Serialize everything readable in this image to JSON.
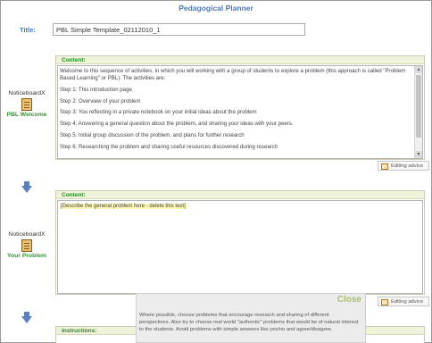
{
  "header": {
    "title": "Pedagogical Planner"
  },
  "title_field": {
    "label": "Title:",
    "value": "PBL Simple Template_02112010_1"
  },
  "activities": [
    {
      "tool_name": "NoticeboardX",
      "tool_label": "PBL Welcome",
      "panel_label": "Content:",
      "paragraphs": [
        "Welcome to this sequence of activities, in which you will working with a group of students to explore a problem (this approach is called \"Problem Based Learning\" or PBL). The activities are:",
        "Step 1: This introduction page",
        "Step 2: Overview of your problem",
        "Step 3: You reflecting in a private notebook on your initial ideas about the problem",
        "Step 4: Answering a general question about the problem, and sharing your ideas with your peers.",
        "Step 5: Initial group discussion of the problem, and plans for further research",
        "Step 6: Researching the problem and sharing useful resources discovered during research"
      ],
      "editing_advice": "Editing advice"
    },
    {
      "tool_name": "NoticeboardX",
      "tool_label": "Your Problem",
      "panel_label": "Content:",
      "placeholder_text": "[Describe the general problem here - delete this text]",
      "editing_advice": "Editing advice"
    },
    {
      "panel_label": "Instructions:"
    }
  ],
  "tooltip": {
    "close_label": "Close",
    "text": "Where possible, choose problems that encourage research and sharing of different perspectives. Also try to choose real world \"authentic\" problems that would be of natural interest to the students. Avoid problems with simple answers like yes/no and agree/disagree."
  },
  "colors": {
    "title_blue": "#4a7ab5",
    "label_green": "#2e9a2e",
    "panel_header_bg": "#eef3d9",
    "highlight_yellow": "#fbf7b5",
    "arrow_blue": "#5a7fc0"
  }
}
